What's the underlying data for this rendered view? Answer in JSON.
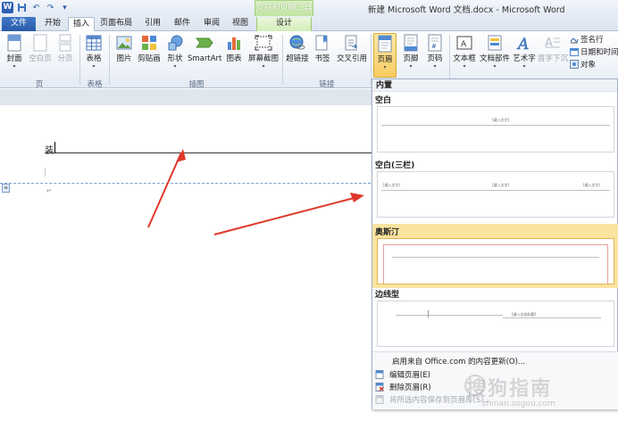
{
  "window": {
    "title": "新建 Microsoft Word 文档.docx - Microsoft Word",
    "contextual_group": "页眉和页脚工具"
  },
  "tabs": [
    {
      "label": "文件"
    },
    {
      "label": "开始"
    },
    {
      "label": "插入"
    },
    {
      "label": "页面布局"
    },
    {
      "label": "引用"
    },
    {
      "label": "邮件"
    },
    {
      "label": "审阅"
    },
    {
      "label": "视图"
    },
    {
      "label": "设计"
    }
  ],
  "ribbon": {
    "pages": {
      "cover": "封面",
      "blank": "空白页",
      "break": "分页",
      "group": "页"
    },
    "tables": {
      "table": "表格",
      "group": "表格"
    },
    "illustrations": {
      "picture": "图片",
      "clipart": "剪贴画",
      "shapes": "形状",
      "smartart": "SmartArt",
      "chart": "图表",
      "screenshot": "屏幕截图",
      "group": "插图"
    },
    "links": {
      "hyperlink": "超链接",
      "bookmark": "书签",
      "crossref": "交叉引用",
      "group": "链接"
    },
    "header_footer": {
      "header": "页眉",
      "footer": "页脚",
      "pagenum": "页码"
    },
    "text": {
      "textbox": "文本框",
      "quickparts": "文档部件",
      "wordart": "艺术字",
      "dropcap": "首字下沉"
    },
    "small": {
      "signature": "签名行",
      "datetime": "日期和时间",
      "object": "对象"
    }
  },
  "document": {
    "header_text": "装"
  },
  "gallery": {
    "section_title": "内置",
    "items": [
      {
        "name": "空白",
        "preview": "[键入文字]"
      },
      {
        "name": "空白(三栏)",
        "preview": "[键入文字]"
      },
      {
        "name": "奥斯汀",
        "preview": ""
      },
      {
        "name": "边线型",
        "preview": "[键入文档标题]"
      }
    ],
    "menu": {
      "update": "启用来自 Office.com 的内容更新(O)...",
      "edit": "编辑页眉(E)",
      "remove": "删除页眉(R)",
      "save": "将所选内容保存到页眉库(S)..."
    }
  },
  "watermark": {
    "text": "搜狗指南",
    "sub": "zhinan.sogou.com"
  },
  "colors": {
    "accent": "#2b5fb3",
    "context": "#9ccc72",
    "selected": "#fbe3a0",
    "arrow": "#e0382c"
  }
}
